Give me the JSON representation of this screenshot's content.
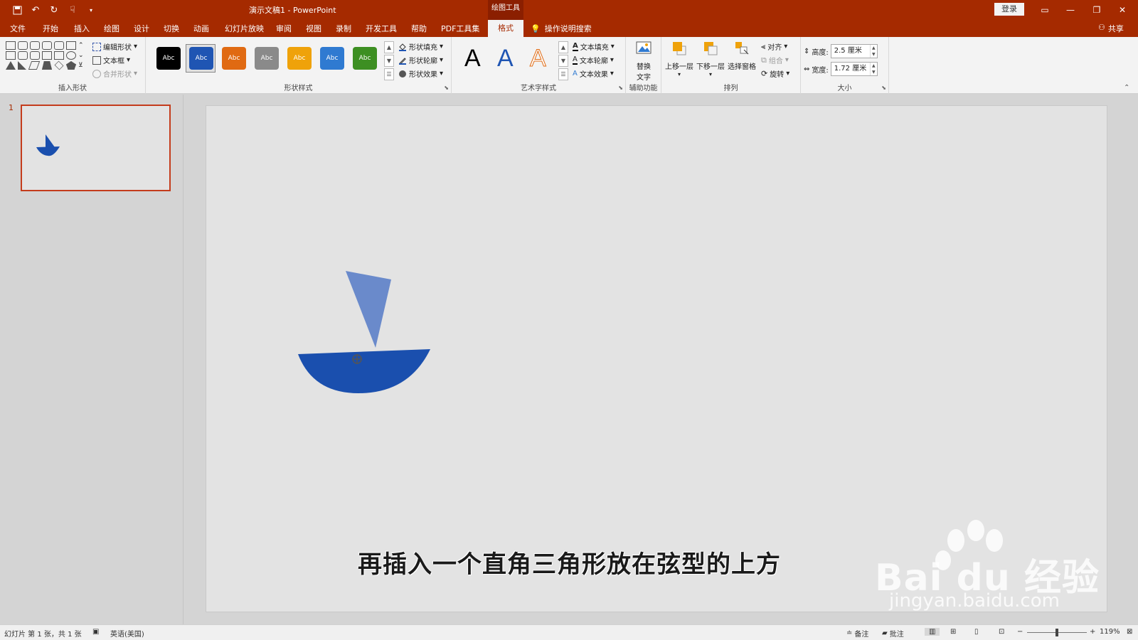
{
  "titlebar": {
    "doc_name": "演示文稿1",
    "separator": " - ",
    "app_name": "PowerPoint",
    "context_tab": "绘图工具",
    "login": "登录"
  },
  "tabs": [
    {
      "label": "文件"
    },
    {
      "label": "开始"
    },
    {
      "label": "插入"
    },
    {
      "label": "绘图"
    },
    {
      "label": "设计"
    },
    {
      "label": "切换"
    },
    {
      "label": "动画"
    },
    {
      "label": "幻灯片放映"
    },
    {
      "label": "审阅"
    },
    {
      "label": "视图"
    },
    {
      "label": "录制"
    },
    {
      "label": "开发工具"
    },
    {
      "label": "帮助"
    },
    {
      "label": "PDF工具集"
    },
    {
      "label": "格式",
      "active": true
    }
  ],
  "tell_me": "操作说明搜索",
  "share": "共享",
  "ribbon": {
    "insert_shapes": {
      "edit_shape": "编辑形状",
      "text_box": "文本框",
      "merge_shapes": "合并形状",
      "label": "插入形状"
    },
    "shape_styles": {
      "swatches": [
        {
          "text": "Abc",
          "color": "#000000"
        },
        {
          "text": "Abc",
          "color": "#1f55b3"
        },
        {
          "text": "Abc",
          "color": "#e06a12"
        },
        {
          "text": "Abc",
          "color": "#8a8a8a"
        },
        {
          "text": "Abc",
          "color": "#efa20a"
        },
        {
          "text": "Abc",
          "color": "#2f7ad1"
        },
        {
          "text": "Abc",
          "color": "#3d8f22"
        }
      ],
      "fill": "形状填充",
      "outline": "形状轮廓",
      "effects": "形状效果",
      "label": "形状样式"
    },
    "wordart": {
      "letters": [
        "A",
        "A",
        "A"
      ],
      "text_fill": "文本填充",
      "text_outline": "文本轮廓",
      "text_effects": "文本效果",
      "label": "艺术字样式"
    },
    "accessibility": {
      "alt_text_line1": "替换",
      "alt_text_line2": "文字",
      "label": "辅助功能"
    },
    "arrange": {
      "bring_forward": "上移一层",
      "send_backward": "下移一层",
      "selection_pane": "选择窗格",
      "align": "对齐",
      "group": "组合",
      "rotate": "旋转",
      "label": "排列"
    },
    "size": {
      "height_label": "高度:",
      "height_value": "2.5 厘米",
      "width_label": "宽度:",
      "width_value": "1.72 厘米",
      "label": "大小"
    }
  },
  "thumbnails": {
    "slide_number": "1"
  },
  "slide": {
    "caption": "再插入一个直角三角形放在弦型的上方",
    "boat_color": "#1a4fae",
    "sail_color": "#6a8acb"
  },
  "watermark": {
    "brand": "Bai du 经验",
    "url": "jingyan.baidu.com"
  },
  "statusbar": {
    "slide_info": "幻灯片 第 1 张，共 1 张",
    "language": "英语(美国)",
    "notes": "备注",
    "comments": "批注",
    "zoom_minus": "−",
    "zoom_plus": "+",
    "zoom": "119%"
  }
}
